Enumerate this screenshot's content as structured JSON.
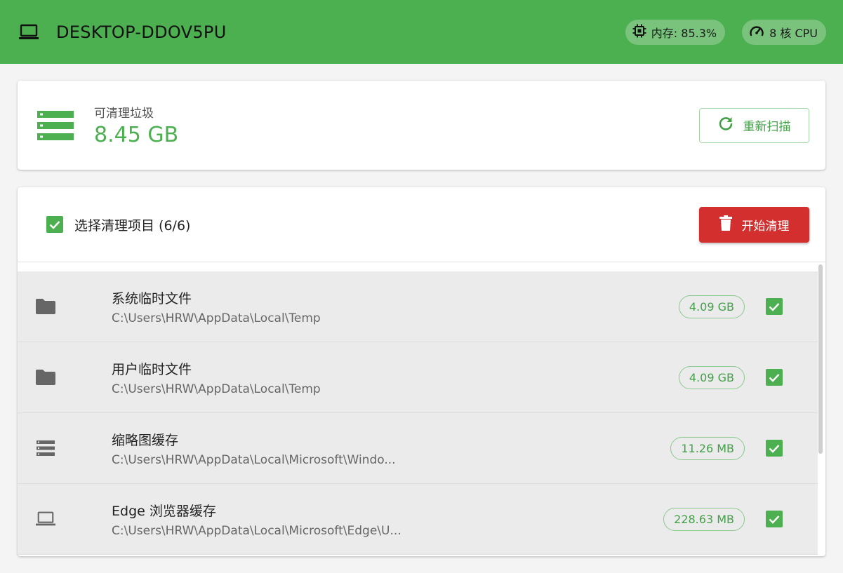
{
  "appbar": {
    "title": "DESKTOP-DDOV5PU",
    "memory_chip": "内存: 85.3%",
    "cpu_chip": "8 核 CPU"
  },
  "summary": {
    "label": "可清理垃圾",
    "size": "8.45 GB",
    "rescan_label": "重新扫描"
  },
  "items": {
    "select_label": "选择清理项目 (6/6)",
    "clean_label": "开始清理",
    "rows": [
      {
        "icon": "folder-icon",
        "name": "系统临时文件",
        "path": "C:\\Users\\HRW\\AppData\\Local\\Temp",
        "size": "4.09 GB",
        "checked": true
      },
      {
        "icon": "folder-icon",
        "name": "用户临时文件",
        "path": "C:\\Users\\HRW\\AppData\\Local\\Temp",
        "size": "4.09 GB",
        "checked": true
      },
      {
        "icon": "storage-icon",
        "name": "缩略图缓存",
        "path": "C:\\Users\\HRW\\AppData\\Local\\Microsoft\\Windo...",
        "size": "11.26 MB",
        "checked": true
      },
      {
        "icon": "laptop-icon",
        "name": "Edge 浏览器缓存",
        "path": "C:\\Users\\HRW\\AppData\\Local\\Microsoft\\Edge\\U...",
        "size": "228.63 MB",
        "checked": true
      }
    ]
  },
  "colors": {
    "primary": "#4caf50",
    "danger": "#d32f2f"
  }
}
